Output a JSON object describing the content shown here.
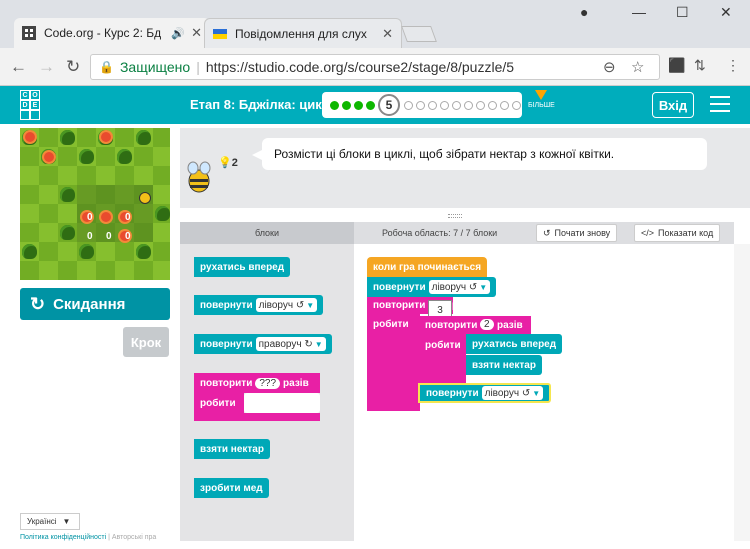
{
  "browser": {
    "tabs": [
      {
        "title": "Code.org - Курс 2: Бд",
        "active": true
      },
      {
        "title": "Повідомлення для слух",
        "active": false
      }
    ],
    "url_secure_label": "Защищено",
    "url_separator": "|",
    "url": "https://studio.code.org/s/course2/stage/8/puzzle/5"
  },
  "header": {
    "logo_letters": [
      "C",
      "O",
      "D",
      "E",
      "",
      ""
    ],
    "stage_title": "Етап 8: Бджілка: цикли",
    "current_level": "5",
    "completed_levels": 4,
    "total_remaining_levels": 10,
    "more_label": "БІЛЬШЕ",
    "signin_label": "Вхід"
  },
  "game": {
    "flower_counts": [
      "0",
      "0",
      "0",
      "0",
      "0"
    ],
    "reset_label": "Скидання",
    "step_label": "Крок"
  },
  "footer": {
    "language": "Українсі",
    "privacy": "Політика конфіденційності",
    "separator": "|",
    "copyright": "Авторські пра"
  },
  "instructions": {
    "text": "Розмісти ці блоки в циклі, щоб зібрати нектар з кожної квітки.",
    "hint_count": "2"
  },
  "toolbox": {
    "header": "блоки",
    "blocks": {
      "move_forward": "рухатись вперед",
      "turn_left_label": "повернути",
      "turn_left_value": "ліворуч ↺",
      "turn_right_label": "повернути",
      "turn_right_value": "праворуч ↻",
      "repeat_label": "повторити",
      "repeat_value": "???",
      "repeat_suffix": "разів",
      "do_label": "робити",
      "get_nectar": "взяти нектар",
      "make_honey": "зробити мед"
    }
  },
  "workspace": {
    "header": "Робоча область: 7 / 7 блоки",
    "restart_label": "Почати знову",
    "show_code_label": "Показати код",
    "when_run": "коли гра починається",
    "turn_label": "повернути",
    "turn_value": "ліворуч ↺",
    "outer_repeat": "повторити",
    "outer_count": "3",
    "outer_suffix": "разів",
    "do_label": "робити",
    "inner_repeat": "повторити",
    "inner_count": "2",
    "inner_suffix": "разів",
    "inner_do": "робити",
    "move_forward": "рухатись вперед",
    "get_nectar": "взяти нектар",
    "turn2_label": "повернути",
    "turn2_value": "ліворуч ↺"
  },
  "colors": {
    "header_bg": "#00adbc",
    "teal_block": "#00a8b7",
    "pink_block": "#e820a5",
    "orange_block": "#f5a623",
    "reset_button": "#0093a4",
    "progress_done": "#0eb700"
  }
}
